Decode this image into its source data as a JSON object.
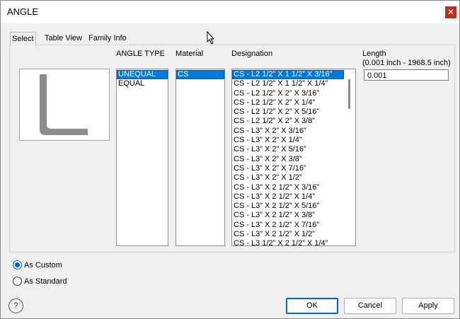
{
  "window": {
    "title": "ANGLE",
    "close_icon": "✕"
  },
  "tabs": [
    "Select",
    "Table View",
    "Family Info"
  ],
  "angle_type": {
    "label": "ANGLE TYPE",
    "items": [
      "UNEQUAL",
      "EQUAL"
    ],
    "selected_index": 0
  },
  "material": {
    "label": "Material",
    "items": [
      "CS"
    ],
    "selected_index": 0
  },
  "designation": {
    "label": "Designation",
    "selected_index": 0,
    "items": [
      "CS - L2 1/2” X 1 1/2” X 3/16”",
      "CS - L2 1/2” X 1 1/2” X 1/4”",
      "CS - L2 1/2” X 2” X 3/16”",
      "CS - L2 1/2” X 2” X 1/4”",
      "CS - L2 1/2” X 2” X 5/16”",
      "CS - L2 1/2” X 2” X 3/8”",
      "CS - L3” X 2” X 3/16”",
      "CS - L3” X 2” X 1/4”",
      "CS - L3” X 2” X 5/16”",
      "CS - L3” X 2” X 3/8”",
      "CS - L3” X 2” X 7/16”",
      "CS - L3” X 2” X 1/2”",
      "CS - L3” X 2 1/2” X 3/16”",
      "CS - L3” X 2 1/2” X 1/4”",
      "CS - L3” X 2 1/2” X 5/16”",
      "CS - L3” X 2 1/2” X 3/8”",
      "CS - L3” X 2 1/2” X 7/16”",
      "CS - L3” X 2 1/2” X 1/2”",
      "CS - L3 1/2” X 2 1/2” X 1/4”"
    ]
  },
  "length": {
    "label": "Length",
    "range": "(0.001 inch - 1968.5 inch)",
    "value": "0.001"
  },
  "radios": {
    "as_custom": "As Custom",
    "as_standard": "As Standard",
    "selected": "as_custom"
  },
  "buttons": {
    "ok": "OK",
    "cancel": "Cancel",
    "apply": "Apply",
    "help": "?"
  },
  "colors": {
    "selection": "#0078d7",
    "close": "#c42b1c",
    "profile": "#8c8c8c"
  }
}
